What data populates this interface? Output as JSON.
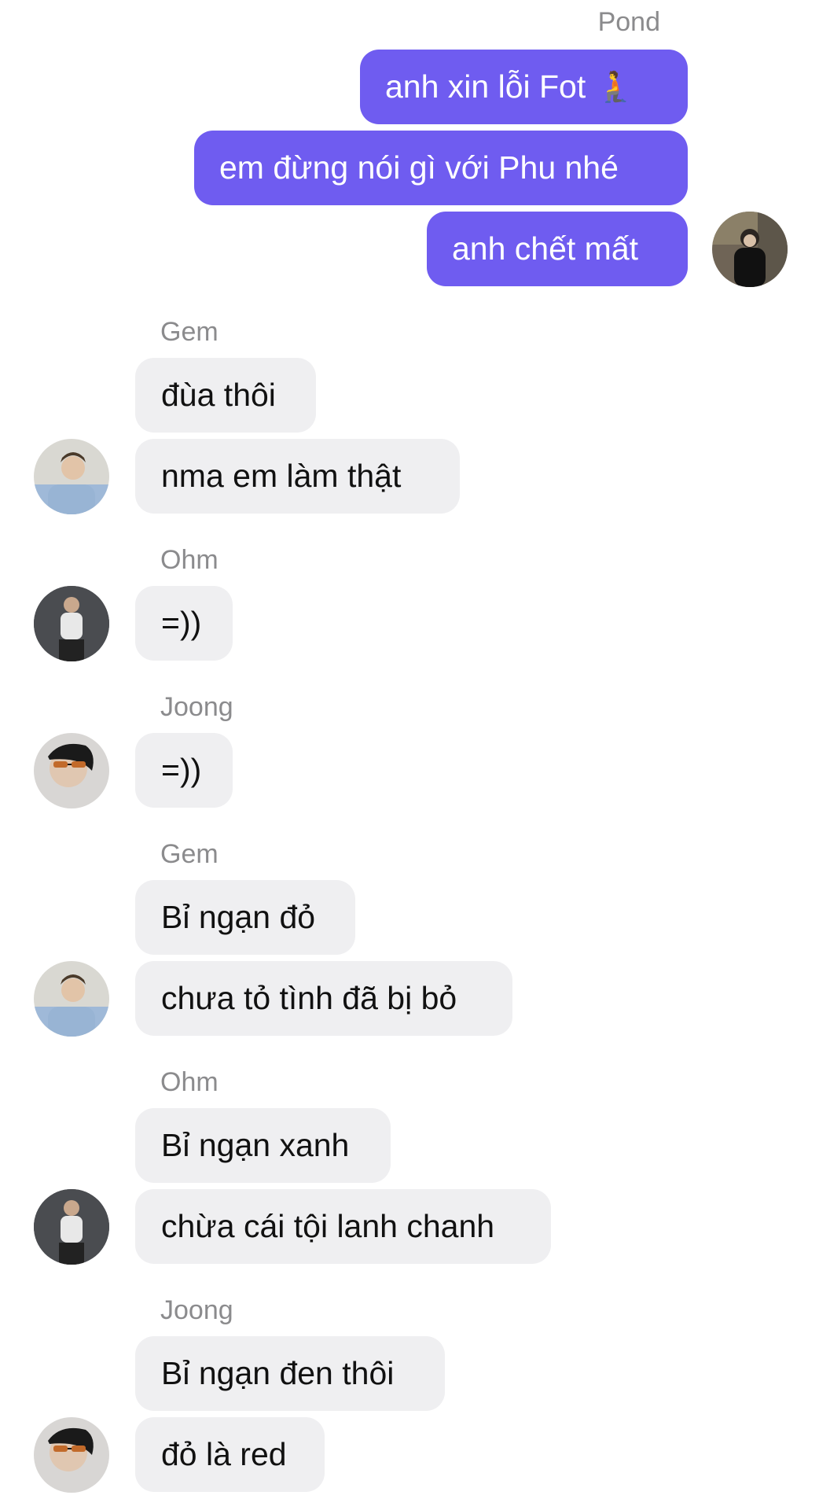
{
  "conversation": {
    "pond": {
      "name": "Pond",
      "messages": [
        "anh xin lỗi Fot",
        "em đừng nói gì với Phu nhé",
        "anh chết mất"
      ],
      "first_message_emoji": "🧎"
    },
    "gem_1": {
      "name": "Gem",
      "messages": [
        "đùa thôi",
        "nma em làm thật"
      ]
    },
    "ohm_1": {
      "name": "Ohm",
      "messages": [
        "=))"
      ]
    },
    "joong_1": {
      "name": "Joong",
      "messages": [
        "=))"
      ]
    },
    "gem_2": {
      "name": "Gem",
      "messages": [
        "Bỉ ngạn đỏ",
        "chưa tỏ tình đã bị bỏ"
      ]
    },
    "ohm_2": {
      "name": "Ohm",
      "messages": [
        "Bỉ ngạn xanh",
        "chừa cái tội lanh chanh"
      ]
    },
    "joong_2": {
      "name": "Joong",
      "messages": [
        "Bỉ ngạn đen thôi",
        "đỏ là red"
      ]
    }
  },
  "colors": {
    "outgoing_bubble": "#6f5cf0",
    "incoming_bubble": "#efeff1",
    "sender_name": "#8b8b8d"
  }
}
